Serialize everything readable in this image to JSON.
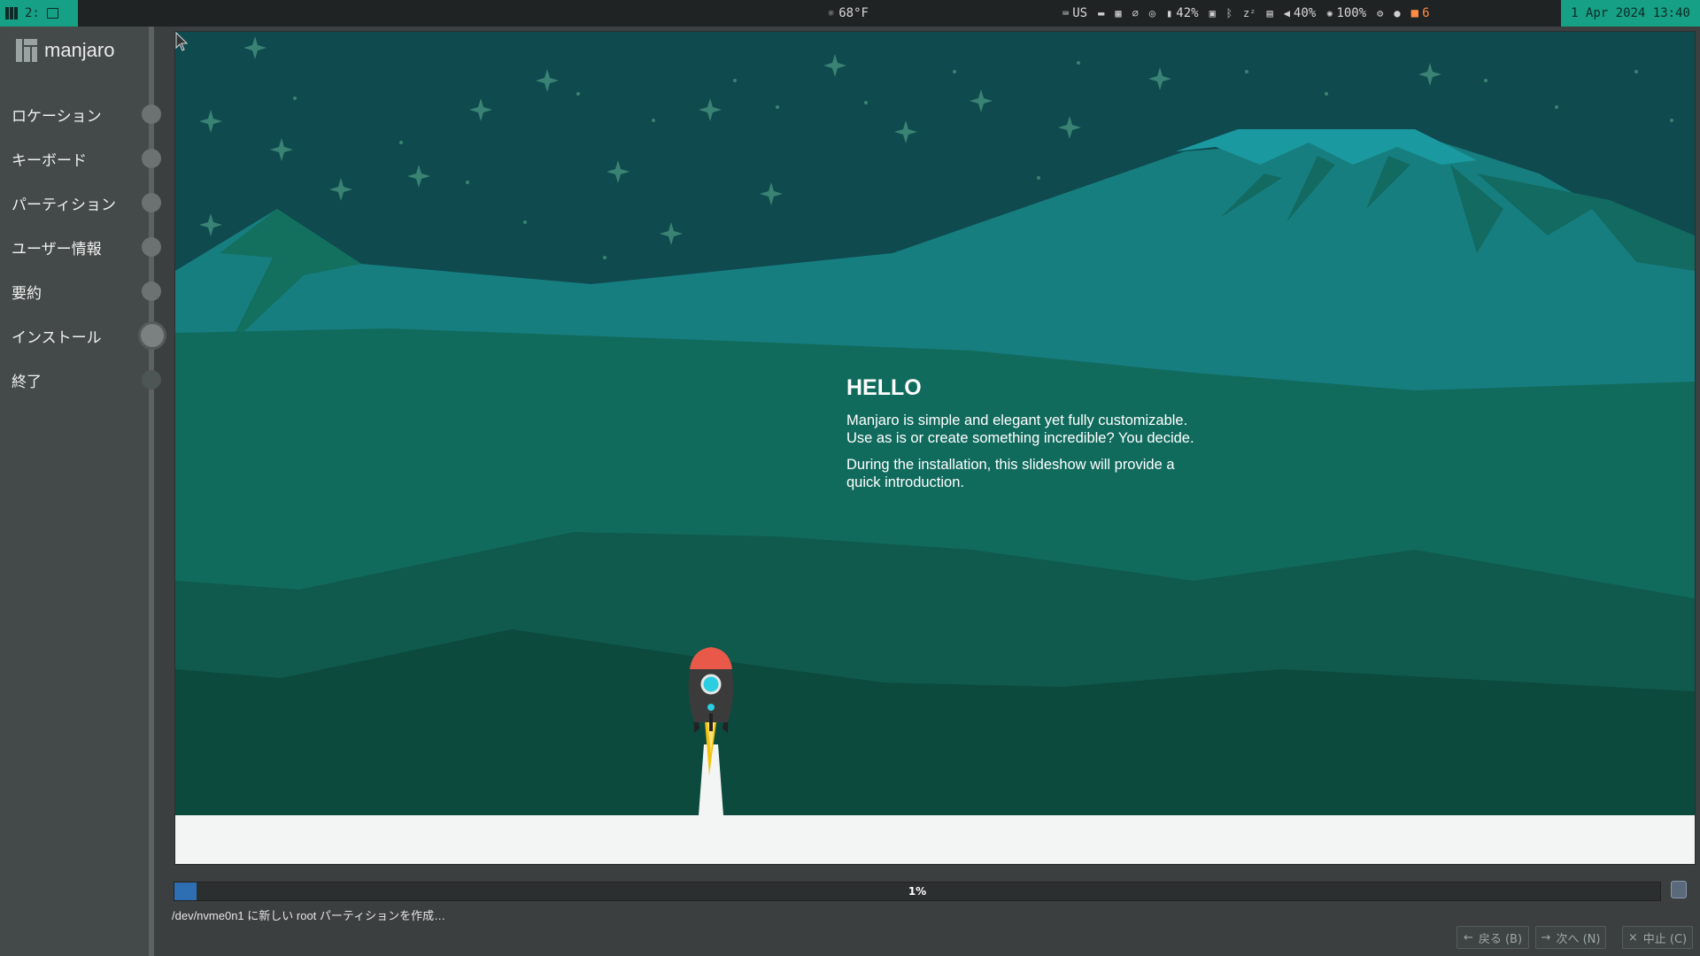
{
  "topbar": {
    "workspace": "2:",
    "weather": "68°F",
    "keyboard": "US",
    "battery": "42%",
    "volume": "40%",
    "brightness": "100%",
    "notifications": "6",
    "clock": "1 Apr 2024 13:40"
  },
  "sidebar": {
    "brand": "manjaro",
    "steps": [
      {
        "label": "ロケーション"
      },
      {
        "label": "キーボード"
      },
      {
        "label": "パーティション"
      },
      {
        "label": "ユーザー情報"
      },
      {
        "label": "要約"
      },
      {
        "label": "インストール"
      },
      {
        "label": "終了"
      }
    ]
  },
  "slide": {
    "title": "HELLO",
    "para1_line1": "Manjaro is simple and elegant yet fully customizable.",
    "para1_line2": "Use as is or create something incredible? You decide.",
    "para2_line1": "During the installation, this slideshow will provide a",
    "para2_line2": "quick introduction."
  },
  "progress": {
    "label": "1%",
    "value": 0.015
  },
  "status": "/dev/nvme0n1 に新しい root パーティションを作成…",
  "nav": {
    "back": "戻る (B)",
    "next": "次へ (N)",
    "cancel": "中止 (C)"
  },
  "colors": {
    "accent": "#16a085",
    "progress": "#2e6fb4"
  }
}
